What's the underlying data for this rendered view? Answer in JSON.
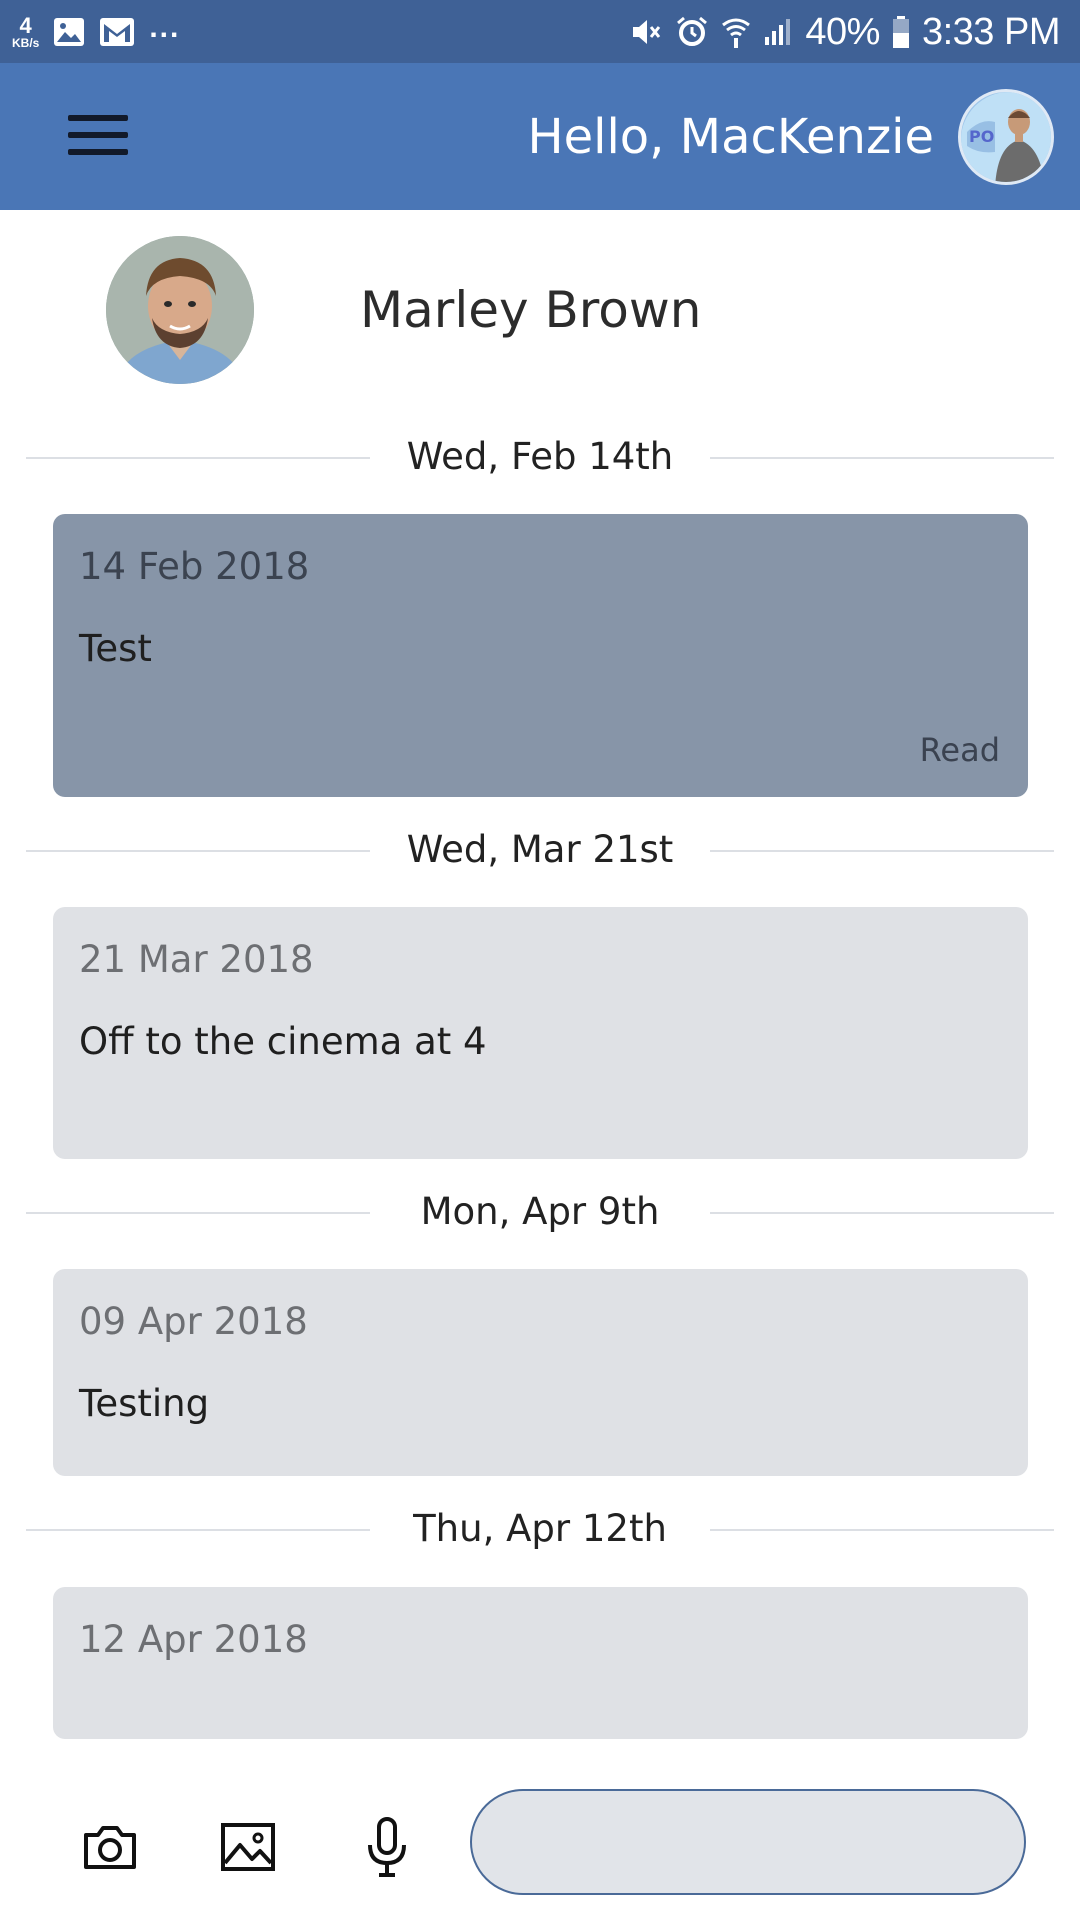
{
  "status_bar": {
    "speed_value": "4",
    "speed_unit": "KB/s",
    "more": "...",
    "battery": "40%",
    "time": "3:33 PM",
    "icons": [
      "gallery-icon",
      "gmail-icon",
      "mute-icon",
      "alarm-icon",
      "wifi-icon",
      "signal-icon",
      "battery-icon"
    ]
  },
  "app_bar": {
    "greeting": "Hello, MacKenzie",
    "color": "#4a76b6"
  },
  "contact": {
    "name": "Marley Brown"
  },
  "conversation": [
    {
      "separator": "Wed, Feb 14th",
      "date": "14 Feb 2018",
      "text": "Test",
      "status": "Read"
    },
    {
      "separator": "Wed, Mar 21st",
      "date": "21 Mar 2018",
      "text": "Off to the cinema at 4",
      "status": ""
    },
    {
      "separator": "Mon, Apr 9th",
      "date": "09 Apr 2018",
      "text": "Testing",
      "status": ""
    },
    {
      "separator": "Thu, Apr 12th",
      "date": "12 Apr 2018",
      "text": "",
      "status": ""
    }
  ],
  "composer": {
    "placeholder": "",
    "icons": [
      "camera-icon",
      "image-icon",
      "microphone-icon"
    ]
  },
  "colors": {
    "status_bar": "#3f6196",
    "read_card": "#8795a8",
    "card": "#dfe1e5"
  }
}
